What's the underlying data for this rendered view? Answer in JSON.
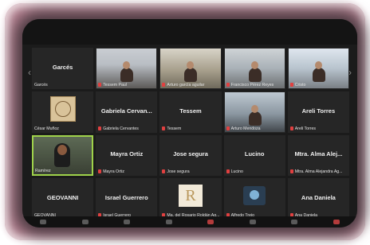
{
  "meeting": {
    "tiles": [
      {
        "kind": "name",
        "center": "Garcés",
        "label": "Garcés",
        "muted": false
      },
      {
        "kind": "video",
        "scene": "video1",
        "label": "Tessem Paul",
        "muted": true
      },
      {
        "kind": "video",
        "scene": "video2",
        "label": "Arturo garcía aguilar",
        "muted": true
      },
      {
        "kind": "video",
        "scene": "video3",
        "label": "Francisco Pérez Reyes",
        "muted": true
      },
      {
        "kind": "video",
        "scene": "video4",
        "label": "Cristo",
        "muted": true
      },
      {
        "kind": "vitruvian",
        "label": "César Muñoz",
        "muted": false
      },
      {
        "kind": "name",
        "center": "Gabriela Cervan...",
        "label": "Gabriela Cervantes",
        "muted": true
      },
      {
        "kind": "name",
        "center": "Tessem",
        "label": "Tessem",
        "muted": true
      },
      {
        "kind": "video",
        "scene": "video5",
        "label": "Arturo Mendoza",
        "muted": true
      },
      {
        "kind": "name",
        "center": "Areli Torres",
        "label": "Areli Torres",
        "muted": true
      },
      {
        "kind": "camera",
        "label": "Ramírez",
        "muted": false,
        "active": true
      },
      {
        "kind": "name",
        "center": "Mayra Ortiz",
        "label": "Mayra Ortiz",
        "muted": true
      },
      {
        "kind": "name",
        "center": "Jose segura",
        "label": "Jose segura",
        "muted": true
      },
      {
        "kind": "name",
        "center": "Lucino",
        "label": "Lucino",
        "muted": true
      },
      {
        "kind": "name",
        "center": "Mtra. Alma Alej...",
        "label": "Mtra. Alma Alejandra Ag...",
        "muted": true
      },
      {
        "kind": "name",
        "center": "GEOVANNI",
        "label": "GEOVANNI",
        "muted": false
      },
      {
        "kind": "name",
        "center": "Israel Guerrero",
        "label": "Israel Guerrero",
        "muted": true
      },
      {
        "kind": "rlogo",
        "label": "Ma. del Rosario Roldán Ag...",
        "muted": true
      },
      {
        "kind": "cat",
        "label": "Alfredo Trejo",
        "muted": true
      },
      {
        "kind": "name",
        "center": "Ana Daniela",
        "label": "Ana Daniela",
        "muted": true
      }
    ]
  },
  "colors": {
    "active_border": "#9fd24a",
    "mic_muted": "#e04040"
  }
}
